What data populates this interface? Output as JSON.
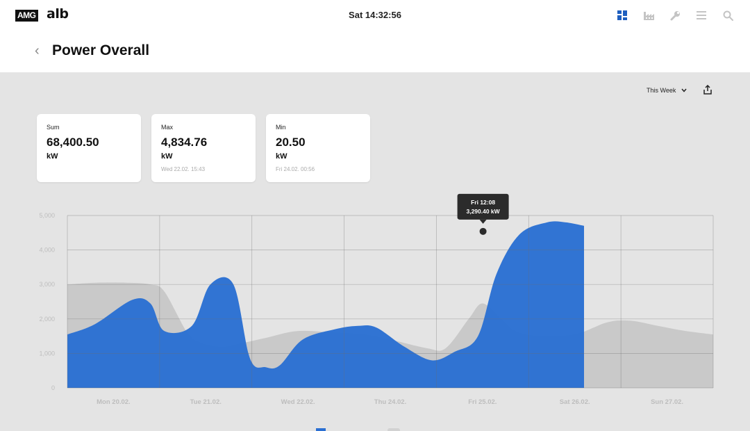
{
  "header": {
    "logo_amg": "AMG",
    "logo_alb": "alb",
    "clock": "Sat 14:32:56",
    "nav_icons": [
      "dashboard-icon",
      "factory-icon",
      "wrench-icon",
      "menu-icon",
      "search-icon"
    ]
  },
  "page": {
    "back_label": "‹",
    "title": "Power Overall",
    "range_label": "This Week"
  },
  "stats": {
    "sum": {
      "label": "Sum",
      "value": "68,400.50",
      "unit": "kW",
      "sub": ""
    },
    "max": {
      "label": "Max",
      "value": "4,834.76",
      "unit": "kW",
      "sub": "Wed 22.02. 15:43"
    },
    "min": {
      "label": "Min",
      "value": "20.50",
      "unit": "kW",
      "sub": "Fri 24.02. 00:56"
    }
  },
  "tooltip": {
    "time": "Fri 12:08",
    "value": "3,290.40 kW"
  },
  "colors": {
    "current": "#2a6fd2",
    "previous": "#c9c9c9",
    "active_icon": "#1f5fbf"
  },
  "chart_data": {
    "type": "area",
    "xlabels": [
      "Mon 20.02.",
      "Tue 21.02.",
      "Wed 22.02.",
      "Thu 24.02.",
      "Fri 25.02.",
      "Sat 26.02.",
      "Sun 27.02."
    ],
    "ylim": [
      0,
      5000
    ],
    "yticks": [
      0,
      1000,
      2000,
      3000,
      4000,
      5000
    ],
    "ytick_labels": [
      "0",
      "1,000",
      "2,000",
      "3,000",
      "4,000",
      "5,000"
    ],
    "grid": true,
    "series": [
      {
        "x": [
          0,
          0.3,
          0.65,
          0.9,
          1.05,
          1.3,
          1.45,
          1.6,
          1.75,
          1.9,
          2.15,
          2.5,
          2.9,
          3.2,
          3.5,
          3.9,
          4.1,
          4.35,
          4.5,
          4.7,
          4.85,
          5.1,
          5.5,
          5.85,
          6.1,
          6.4,
          6.7,
          7.0
        ],
        "y": [
          3000,
          3050,
          3050,
          3000,
          2800,
          1600,
          1300,
          1200,
          1200,
          1300,
          1450,
          1650,
          1600,
          1550,
          1400,
          1150,
          1150,
          2000,
          2450,
          2000,
          1650,
          1500,
          1550,
          1900,
          1950,
          1800,
          1650,
          1550
        ]
      },
      {
        "x": [
          0,
          0.3,
          0.7,
          0.9,
          1.05,
          1.35,
          1.55,
          1.8,
          1.98,
          2.15,
          2.3,
          2.55,
          2.9,
          3.15,
          3.35,
          3.65,
          3.95,
          4.2,
          4.45,
          4.65,
          4.9,
          5.2,
          5.4,
          5.6
        ],
        "y": [
          1550,
          1850,
          2550,
          2450,
          1650,
          1800,
          3000,
          3000,
          850,
          600,
          650,
          1400,
          1700,
          1800,
          1750,
          1200,
          800,
          1050,
          1500,
          3300,
          4450,
          4800,
          4800,
          4700
        ]
      }
    ]
  }
}
